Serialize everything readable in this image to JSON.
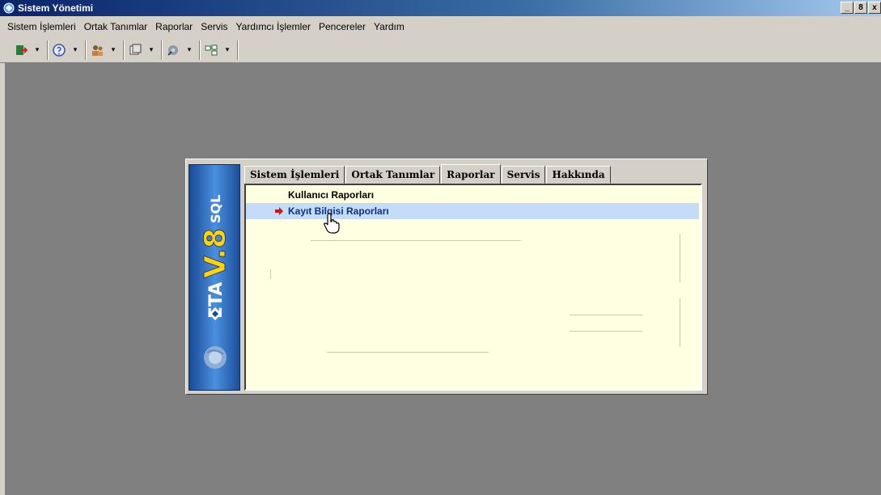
{
  "window": {
    "title": "Sistem Yönetimi",
    "controls": [
      "_",
      "8",
      "x"
    ]
  },
  "menu": [
    "Sistem İşlemleri",
    "Ortak Tanımlar",
    "Raporlar",
    "Servis",
    "Yardımcı İşlemler",
    "Pencereler",
    "Yardım"
  ],
  "toolbar": {
    "groups": [
      {
        "icon": "login-icon",
        "color": "#2a7a3a"
      },
      {
        "icon": "help-icon",
        "color": "#3355aa"
      },
      {
        "icon": "users-icon",
        "color": "#8a5a20"
      },
      {
        "icon": "database-icon",
        "color": "#404040"
      },
      {
        "icon": "tools-icon",
        "color": "#556677"
      },
      {
        "icon": "windows-icon",
        "color": "#2a6a2a"
      }
    ],
    "dropdown_glyph": "▾"
  },
  "dialog": {
    "brand": "ETA V.8 SQL",
    "tabs": [
      "Sistem İşlemleri",
      "Ortak Tanımlar",
      "Raporlar",
      "Servis",
      "Hakkında"
    ],
    "active_tab": "Raporlar",
    "items": [
      {
        "label": "Kullanıcı Raporları",
        "selected": false
      },
      {
        "label": "Kayıt Bilgisi Raporları",
        "selected": true
      }
    ],
    "marker_glyph": "◆"
  },
  "colors": {
    "desktop": "#808080",
    "chrome": "#d4d0c8",
    "panel": "#ffffe1",
    "selection": "#c4dcf7",
    "marker": "#e01010"
  }
}
